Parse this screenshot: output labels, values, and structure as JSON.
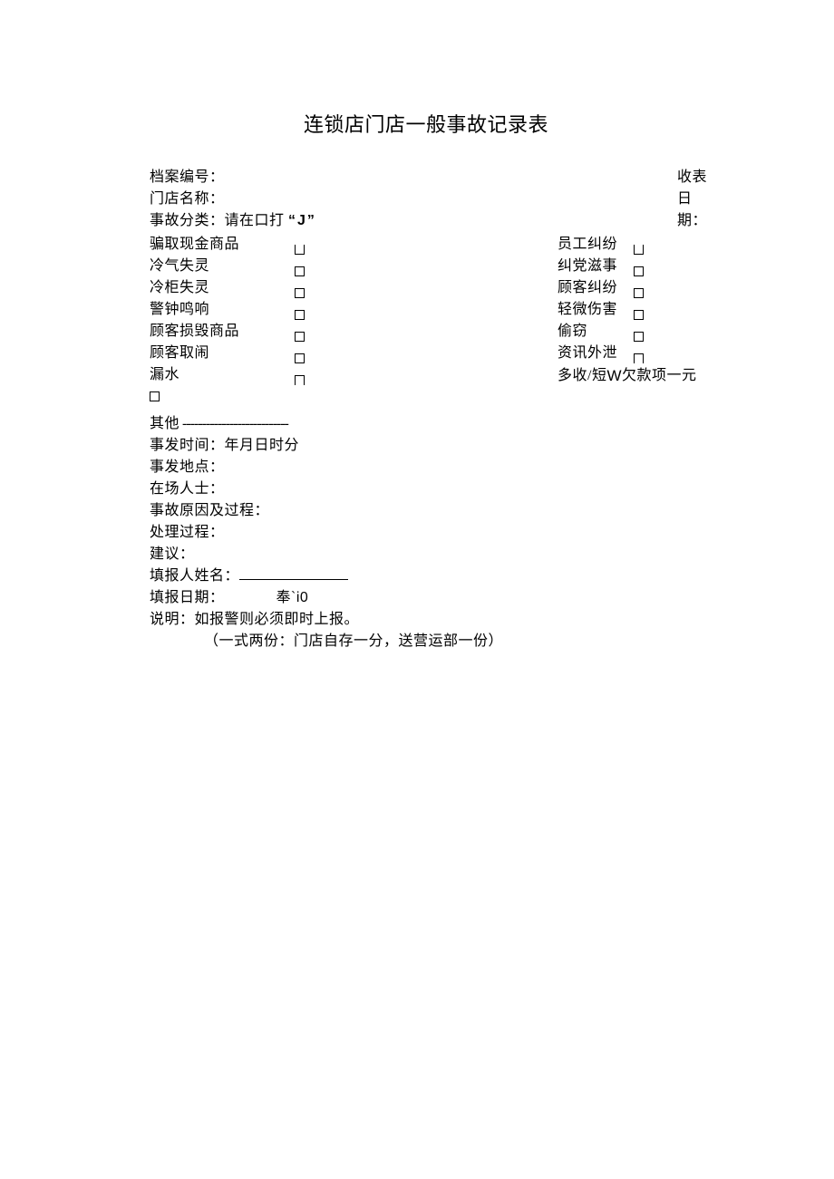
{
  "title": "连锁店门店一般事故记录表",
  "header": {
    "file_no_label": "档案编号：",
    "receive_date_label": "收表日期：",
    "store_name_label": "门店名称："
  },
  "category": {
    "instruction_prefix": "事故分类：请在口打",
    "instruction_mark": "“J”",
    "left": [
      "骗取现金商品",
      "冷气失灵",
      "冷柜失灵",
      "警钟鸣响",
      "顾客损毁商品",
      "顾客取闹",
      "漏水"
    ],
    "right": [
      "员工纠纷",
      "纠党滋事",
      "顾客纠纷",
      "轻微伤害",
      "偷窃",
      "资讯外泄"
    ],
    "right_last_prefix": "多收/短",
    "right_last_mid1": "W",
    "right_last_mid2": "欠",
    "right_last_suffix": "款项一元",
    "other_label": "其他",
    "other_dashes": " ---------------------------"
  },
  "fields": {
    "time_label": "事发时间：年月日时分",
    "location_label": "事发地点：",
    "present_label": "在场人士：",
    "cause_label": "事故原因及过程：",
    "process_label": "处理过程：",
    "suggestion_label": "建议：",
    "reporter_name_label": "填报人姓名：",
    "report_date_label": "填报日期：",
    "report_date_odd": "奉`i0"
  },
  "notes": {
    "line1": "说明：如报警则必须即时上报。",
    "line2": "（一式两份：门店自存一分，送营运部一份）"
  }
}
